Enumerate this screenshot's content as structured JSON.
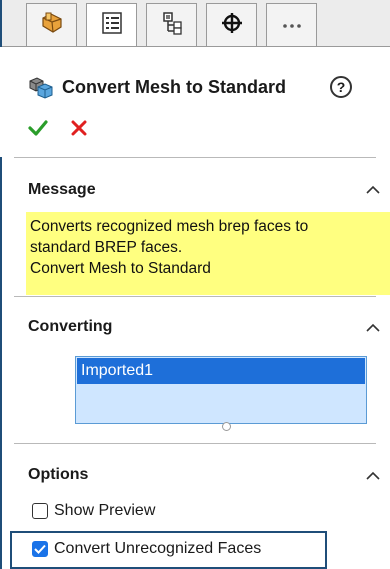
{
  "tabs": [
    {
      "icon": "feature-manager-icon",
      "active": false
    },
    {
      "icon": "property-manager-icon",
      "active": true
    },
    {
      "icon": "configuration-manager-icon",
      "active": false
    },
    {
      "icon": "dimxpert-icon",
      "active": false
    },
    {
      "icon": "more-icon",
      "active": false
    }
  ],
  "header": {
    "title": "Convert Mesh to Standard",
    "help": "?"
  },
  "message": {
    "title": "Message",
    "lines": [
      "Converts recognized mesh brep faces to",
      "standard BREP faces.",
      "Convert Mesh to Standard"
    ]
  },
  "converting": {
    "title": "Converting",
    "items": [
      "Imported1"
    ]
  },
  "options": {
    "title": "Options",
    "show_preview": {
      "label": "Show Preview",
      "checked": false
    },
    "convert_unrecognized": {
      "label": "Convert Unrecognized Faces",
      "checked": true
    }
  },
  "colors": {
    "accent": "#1a73e8",
    "message_bg": "#ffff80",
    "selection": "#1e6fd9",
    "frame": "#1f4e79"
  }
}
